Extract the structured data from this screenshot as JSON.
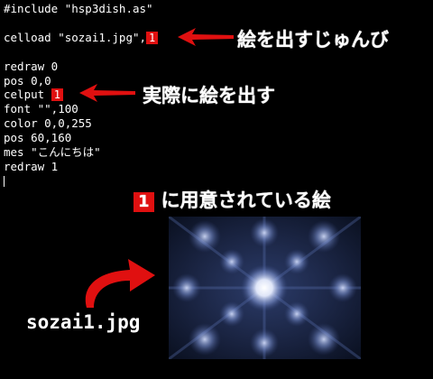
{
  "code": {
    "line1": "#include \"hsp3dish.as\"",
    "line2_prefix": "celload \"sozai1.jpg\",",
    "line2_badge": "1",
    "line3": "redraw 0",
    "line4": "pos 0,0",
    "line5_prefix": "celput ",
    "line5_badge": "1",
    "line6": "font \"\",100",
    "line7": "color 0,0,255",
    "line8": "pos 60,160",
    "line9": "mes \"こんにちは\"",
    "line10": "redraw 1"
  },
  "annotations": {
    "load_label": "絵を出すじゅんび",
    "draw_label": "実際に絵を出す",
    "prepared_badge": "1",
    "prepared_label": "に用意されている絵",
    "filename": "sozai1.jpg"
  },
  "colors": {
    "background": "#000000",
    "text": "#ffffff",
    "accent_red": "#e01010",
    "image_blue": "#6f86c8"
  }
}
